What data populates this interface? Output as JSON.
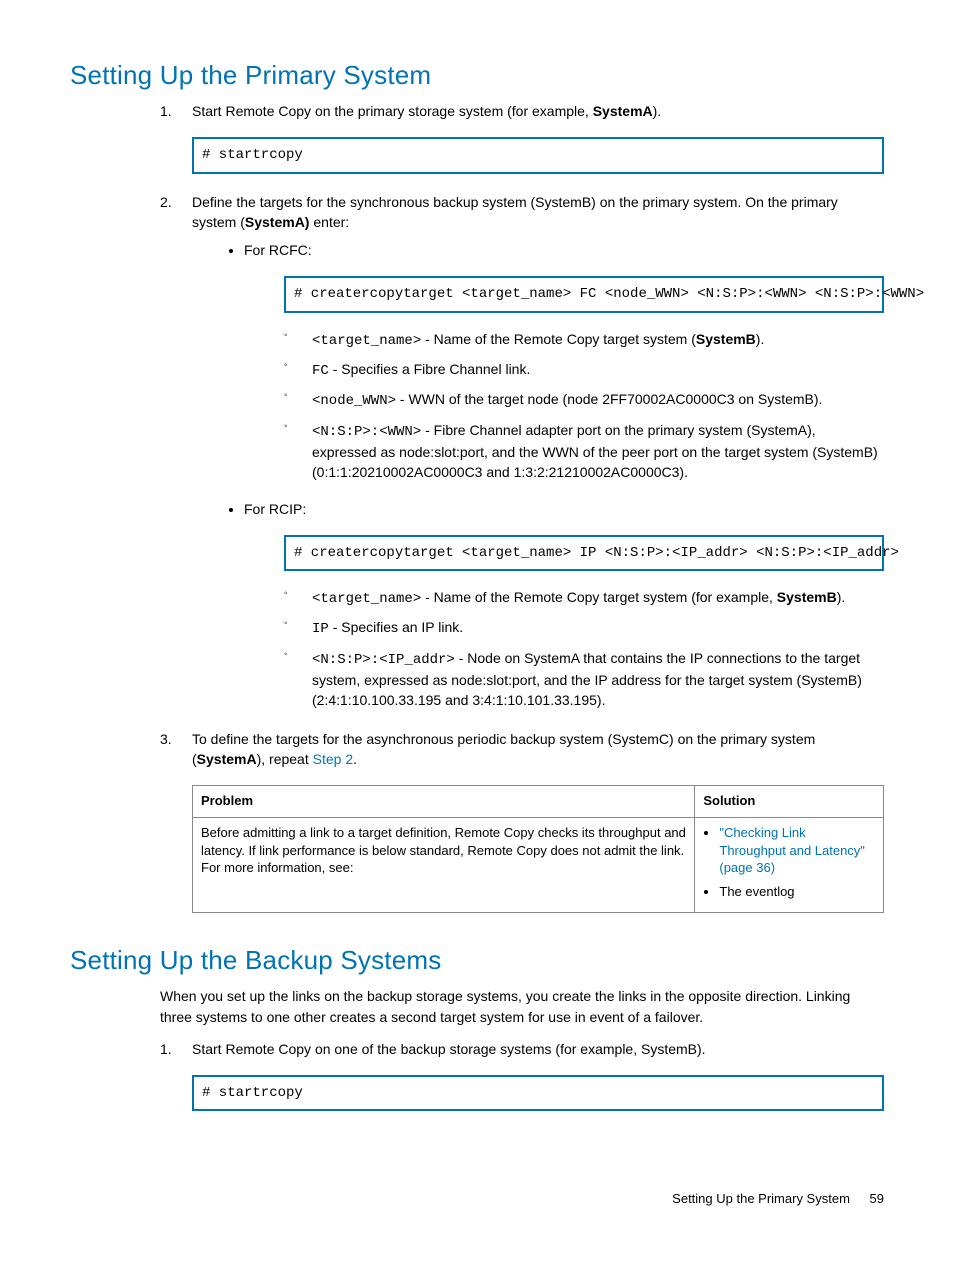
{
  "section1": {
    "heading": "Setting Up the Primary System",
    "step1": {
      "num": "1.",
      "text_pre": "Start Remote Copy on the primary storage system (for example, ",
      "bold": "SystemA",
      "text_post": ").",
      "code": "# startrcopy"
    },
    "step2": {
      "num": "2.",
      "text_pre": "Define the targets for the synchronous backup system (SystemB) on the primary system. On the primary system (",
      "bold": "SystemA)",
      "text_post": " enter:",
      "rcfc": {
        "label": "For RCFC:",
        "code": "# creatercopytarget <target_name> FC <node_WWN> <N:S:P>:<WWN> <N:S:P>:<WWN>",
        "sub1_code": "<target_name>",
        "sub1_text": " - Name of the Remote Copy target system (",
        "sub1_bold": "SystemB",
        "sub1_post": ").",
        "sub2_code": "FC",
        "sub2_text": " - Specifies a Fibre Channel link.",
        "sub3_code": "<node_WWN>",
        "sub3_text": " - WWN of the target node (node 2FF70002AC0000C3 on SystemB).",
        "sub4_code": "<N:S:P>:<WWN>",
        "sub4_text": " - Fibre Channel adapter port on the primary system (SystemA), expressed as node:slot:port, and the WWN of the peer port on the target system (SystemB) (0:1:1:20210002AC0000C3 and 1:3:2:21210002AC0000C3)."
      },
      "rcip": {
        "label": "For RCIP:",
        "code": "# creatercopytarget <target_name> IP <N:S:P>:<IP_addr> <N:S:P>:<IP_addr>",
        "sub1_code": "<target_name>",
        "sub1_text": " - Name of the Remote Copy target system (for example, ",
        "sub1_bold": "SystemB",
        "sub1_post": ").",
        "sub2_code": "IP",
        "sub2_text": " - Specifies an IP link.",
        "sub3_code": "<N:S:P>:<IP_addr>",
        "sub3_text": " - Node on SystemA that contains the IP connections to the target system, expressed as node:slot:port, and the IP address for the target system (SystemB) (2:4:1:10.100.33.195 and 3:4:1:10.101.33.195)."
      }
    },
    "step3": {
      "num": "3.",
      "text_pre": "To define the targets for the asynchronous periodic backup system (SystemC) on the primary system (",
      "bold": "SystemA",
      "text_mid": "), repeat ",
      "link": "Step 2",
      "text_post": "."
    },
    "table": {
      "th1": "Problem",
      "th2": "Solution",
      "td1": "Before admitting a link to a target definition, Remote Copy checks its throughput and latency. If link performance is below standard, Remote Copy does not admit the link. For more information, see:",
      "td2_link": "\"Checking Link Throughput and Latency\" (page 36)",
      "td2_item2": "The eventlog"
    }
  },
  "section2": {
    "heading": "Setting Up the Backup Systems",
    "intro": "When you set up the links on the backup storage systems, you create the links in the opposite direction. Linking three systems to one other creates a second target system for use in event of a failover.",
    "step1": {
      "num": "1.",
      "text": "Start Remote Copy on one of the backup storage systems (for example, SystemB).",
      "code": "# startrcopy"
    }
  },
  "footer": {
    "text": "Setting Up the Primary System",
    "page": "59"
  }
}
